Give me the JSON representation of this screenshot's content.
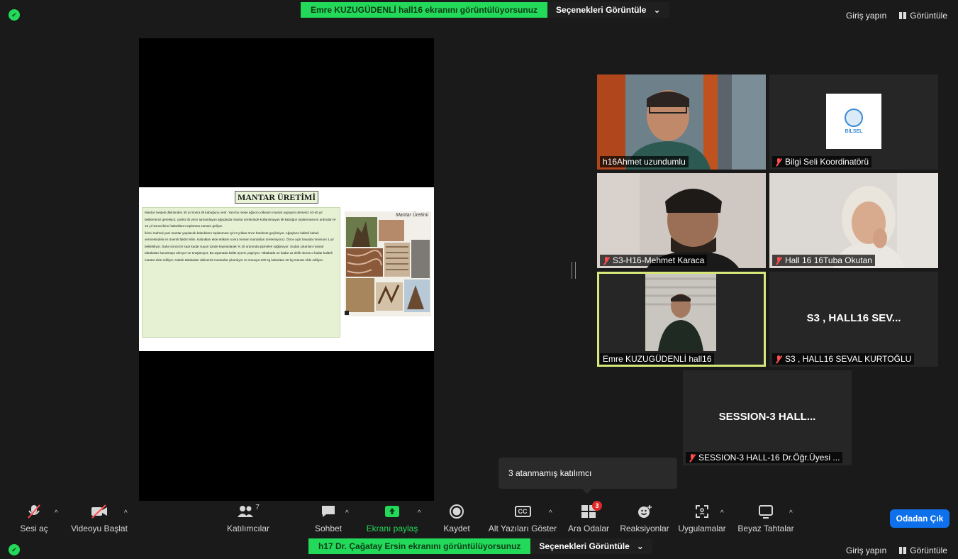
{
  "banner_top": {
    "message": "Emre KUZUGÜDENLİ hall16 ekranını görüntülüyorsunuz",
    "options": "Seçenekleri Görüntüle"
  },
  "banner_bottom": {
    "message": "h17 Dr. Çağatay Ersin ekranını görüntülüyorsunuz",
    "options": "Seçenekleri Görüntüle"
  },
  "top_right": {
    "signin": "Giriş yapın",
    "view": "Görüntüle"
  },
  "shared_doc": {
    "title": "MANTAR ÜRETİMİ",
    "paragraph1": "Mantar meşesi dikiminden 30 yıl sonra ilk kabuğunu verir. Yani bu meşe ağacını dikeyim mantar yapayım derseniz 40-45 yıl beklemeniz gerekiyor, çünkü 30 yılını tamamlayan ağaçlarda mantar üretiminde kullanılmayan ilk kabuğun toplanmasının ardından 9-15 yıl sonra ikinci kabukların toplanma zamanı geliyor.",
    "paragraph2": "İkinci mahsul yani mantar yapılacak kabukların toplanması için 9 yıldan önce harekete geçilmiyor. Ağaçların kaliteli kabuk vermesindeki en önemli faktör iklim. Kabukları elde ettikten sonra hemen mantarları üretemiyoruz. Önce açık havada minimum 1 yıl bekletiliyor. Daha sonra bir saat kadar suyun içinde kaynatılarak % 20 oranında şişmeleri sağlanıyor. Sudan çıkarılan mantar tabakaları kurutmaya alınıyor ve tıraşlanıyor. Bu aşamada kalite ayrımı yapılıyor. Tabakada ne kadar az delik olursa o kadar kaliteli mantar elde ediliyor. Kabuk tabakaları delinerek mantarlar çıkarılıyor ve sonuçta 100 kg kabuktan 40 kg mantar elde ediliyor.",
    "image_caption": "Mantar Üretimi"
  },
  "participants": [
    {
      "name": "h16Ahmet uzundumlu",
      "muted": false
    },
    {
      "name": "Bilgi Seli Koordinatörü",
      "muted": true,
      "logo_text": "BİLSEL"
    },
    {
      "name": "S3-H16-Mehmet Karaca",
      "muted": true
    },
    {
      "name": "Hall 16 16Tuba Okutan",
      "muted": true
    },
    {
      "name": "Emre KUZUGÜDENLİ hall16",
      "muted": false
    },
    {
      "name": "S3 , HALL16 SEVAL KURTOĞLU",
      "muted": true,
      "big_label": "S3 , HALL16 SEV..."
    },
    {
      "name": "SESSION-3 HALL-16 Dr.Öğr.Üyesi ...",
      "muted": true,
      "big_label": "SESSION-3  HALL..."
    }
  ],
  "tooltip": "3 atanmamış katılımcı",
  "toolbar": {
    "audio": "Sesi aç",
    "video": "Videoyu Başlat",
    "participants": "Katılımcılar",
    "participants_count": "7",
    "chat": "Sohbet",
    "share": "Ekranı paylaş",
    "record": "Kaydet",
    "captions": "Alt Yazıları Göster",
    "captions_icon": "CC",
    "breakout": "Ara Odalar",
    "breakout_badge": "3",
    "reactions": "Reaksiyonlar",
    "apps": "Uygulamalar",
    "whiteboard": "Beyaz Tahtalar",
    "leave": "Odadan Çık"
  },
  "colors": {
    "accent_green": "#23d959",
    "active_speaker": "#d7e77a",
    "leave_blue": "#0e71eb",
    "badge_red": "#e02828"
  }
}
